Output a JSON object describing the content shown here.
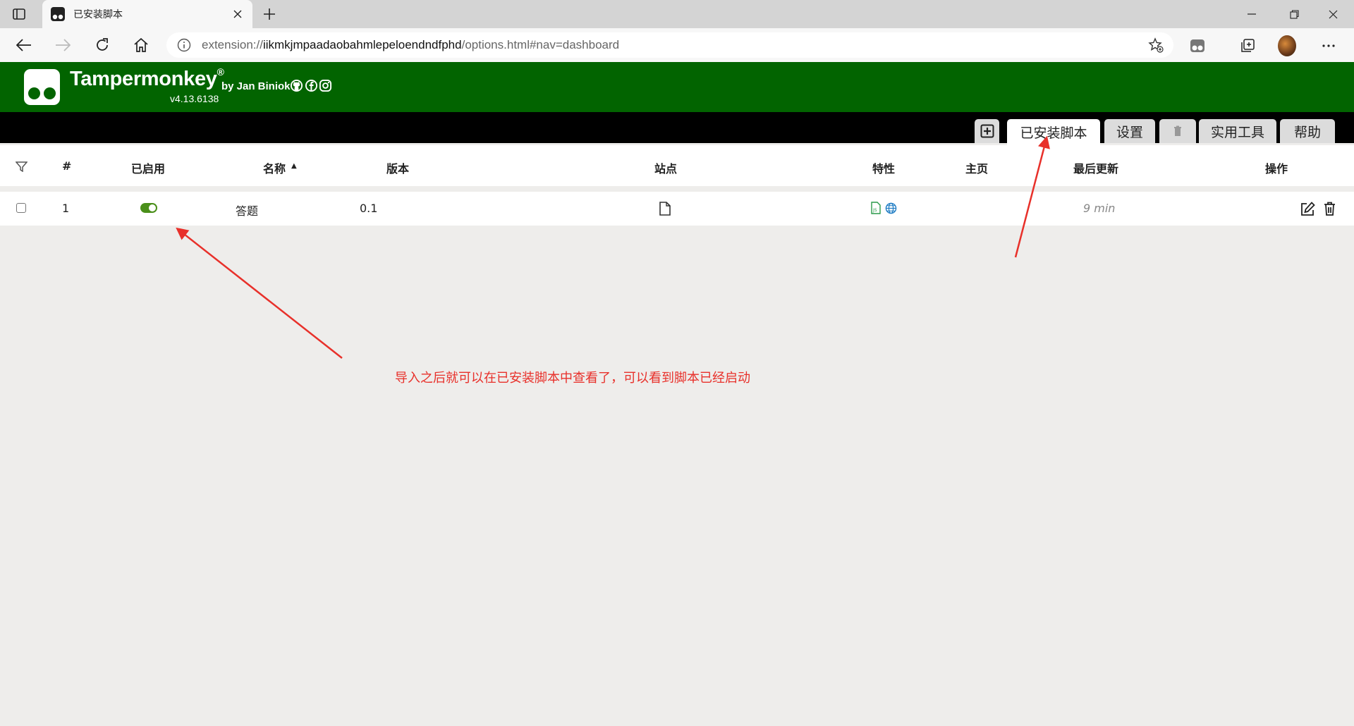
{
  "browser": {
    "tab_title": "已安装脚本",
    "url_prefix": "extension://",
    "url_host": "iikmkjmpaadaobahmlepeloendndfphd",
    "url_path": "/options.html#nav=dashboard"
  },
  "tm_header": {
    "name": "Tampermonkey",
    "registered": "®",
    "by": "by Jan Biniok",
    "version": "v4.13.6138",
    "brand_color": "#026400"
  },
  "nav_tabs": {
    "installed": "已安装脚本",
    "settings": "设置",
    "utilities": "实用工具",
    "help": "帮助"
  },
  "table": {
    "headers": {
      "index": "#",
      "enabled": "已启用",
      "name": "名称",
      "sort_indicator": "▲",
      "version": "版本",
      "sites": "站点",
      "features": "特性",
      "homepage": "主页",
      "last_updated": "最后更新",
      "actions": "操作"
    },
    "rows": [
      {
        "index": "1",
        "enabled": true,
        "name": "答题",
        "version": "0.1",
        "last_updated": "9 min"
      }
    ]
  },
  "annotation": {
    "text": "导入之后就可以在已安装脚本中查看了，可以看到脚本已经启动",
    "color": "#e8302a"
  }
}
